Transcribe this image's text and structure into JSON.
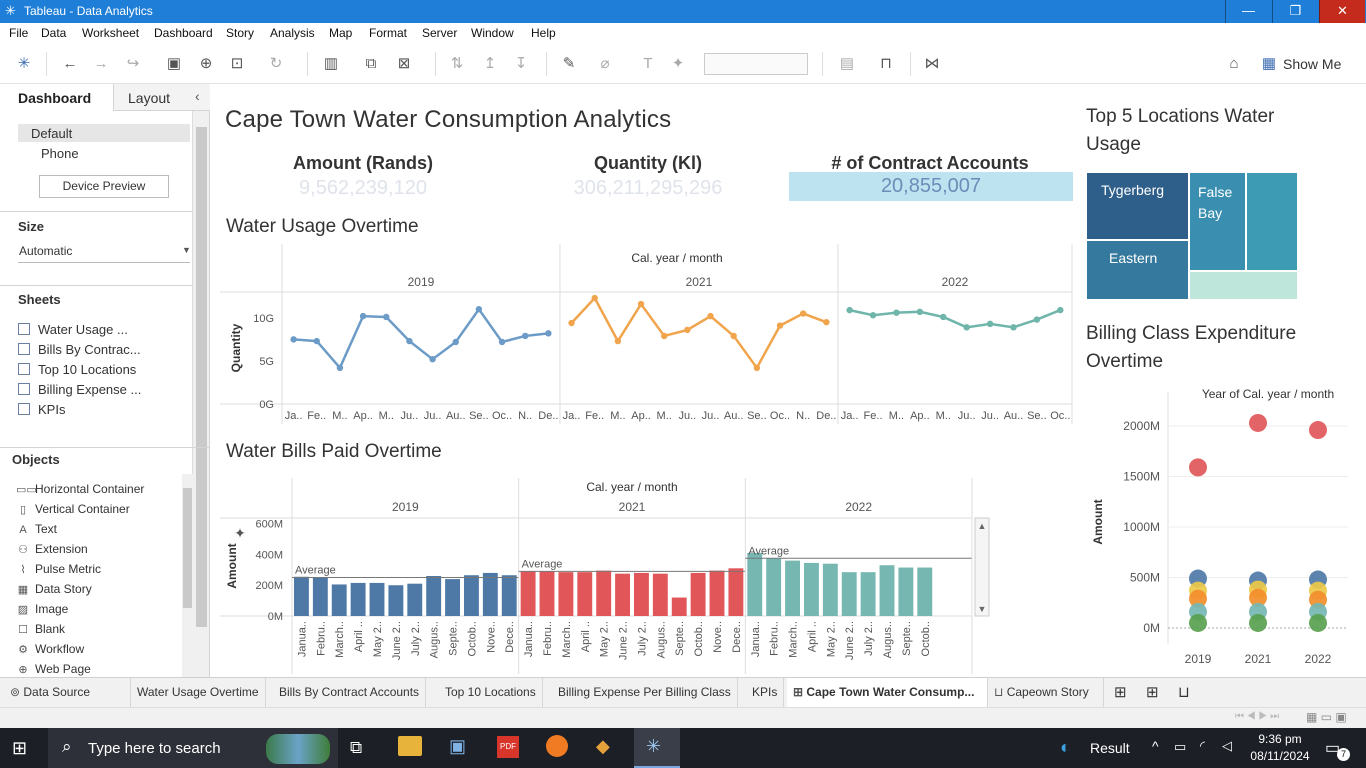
{
  "window": {
    "title": "Tableau - Data Analytics"
  },
  "menu": [
    "File",
    "Data",
    "Worksheet",
    "Dashboard",
    "Story",
    "Analysis",
    "Map",
    "Format",
    "Server",
    "Window",
    "Help"
  ],
  "toolbar": {
    "show_me": "Show Me"
  },
  "left": {
    "tab_dashboard": "Dashboard",
    "tab_layout": "Layout",
    "device_default": "Default",
    "device_phone": "Phone",
    "device_preview": "Device Preview",
    "size_label": "Size",
    "size_value": "Automatic",
    "sheets_label": "Sheets",
    "sheets": [
      "Water Usage ...",
      "Bills By Contrac...",
      "Top 10 Locations",
      "Billing Expense ...",
      "KPIs"
    ],
    "objects_label": "Objects",
    "objects": [
      {
        "label": "Horizontal Container",
        "icon": "horizontal-container-icon"
      },
      {
        "label": "Vertical Container",
        "icon": "vertical-container-icon"
      },
      {
        "label": "Text",
        "icon": "text-icon"
      },
      {
        "label": "Extension",
        "icon": "extension-icon"
      },
      {
        "label": "Pulse Metric",
        "icon": "pulse-metric-icon"
      },
      {
        "label": "Data Story",
        "icon": "data-story-icon"
      },
      {
        "label": "Image",
        "icon": "image-icon"
      },
      {
        "label": "Blank",
        "icon": "blank-icon"
      },
      {
        "label": "Workflow",
        "icon": "workflow-icon"
      },
      {
        "label": "Web Page",
        "icon": "web-page-icon"
      }
    ]
  },
  "dashboard": {
    "title": "Cape Town Water Consumption Analytics",
    "kpis": [
      {
        "label": "Amount (Rands)",
        "value": "9,562,239,120"
      },
      {
        "label": "Quantity (Kl)",
        "value": "306,211,295,296"
      },
      {
        "label": "# of Contract Accounts",
        "value": "20,855,007"
      }
    ],
    "usage_title": "Water Usage Overtime",
    "bills_title": "Water Bills Paid Overtime",
    "top5_title": "Top 5 Locations Water Usage",
    "billing_title": "Billing Class Expenditure Overtime"
  },
  "chart_data": [
    {
      "type": "line",
      "name": "Water Usage Overtime",
      "header": "Cal. year / month",
      "ylabel": "Quantity",
      "yticks": [
        "10G",
        "5G",
        "0G"
      ],
      "ylim": [
        0,
        13
      ],
      "panels": [
        {
          "year": "2019",
          "color": "#6b9bc6",
          "x": [
            "Ja..",
            "Fe..",
            "M..",
            "Ap..",
            "M..",
            "Ju..",
            "Ju..",
            "Au..",
            "Se..",
            "Oc..",
            "N..",
            "De.."
          ],
          "values": [
            7.5,
            7.3,
            4.2,
            10.2,
            10.1,
            7.3,
            5.2,
            7.2,
            11.0,
            7.2,
            7.9,
            8.2
          ]
        },
        {
          "year": "2021",
          "color": "#f0a44b",
          "x": [
            "Ja..",
            "Fe..",
            "M..",
            "Ap..",
            "M..",
            "Ju..",
            "Ju..",
            "Au..",
            "Se..",
            "Oc..",
            "N..",
            "De.."
          ],
          "values": [
            9.4,
            12.3,
            7.3,
            11.6,
            7.9,
            8.6,
            10.2,
            7.9,
            4.2,
            9.1,
            10.5,
            9.5
          ]
        },
        {
          "year": "2022",
          "color": "#6fb5aa",
          "x": [
            "Ja..",
            "Fe..",
            "M..",
            "Ap..",
            "M..",
            "Ju..",
            "Ju..",
            "Au..",
            "Se..",
            "Oc.."
          ],
          "values": [
            10.9,
            10.3,
            10.6,
            10.7,
            10.1,
            8.9,
            9.3,
            8.9,
            9.8,
            10.9
          ]
        }
      ]
    },
    {
      "type": "bar",
      "name": "Water Bills Paid Overtime",
      "header": "Cal. year / month",
      "ylabel": "Amount",
      "yticks": [
        "600M",
        "400M",
        "200M",
        "0M"
      ],
      "ylim": [
        0,
        650
      ],
      "reference_label": "Average",
      "panels": [
        {
          "year": "2019",
          "color": "#4e79a7",
          "average": 250,
          "x": [
            "Janua..",
            "Febru..",
            "March..",
            "April ..",
            "May 2..",
            "June 2..",
            "July 2..",
            "Augus..",
            "Septe..",
            "Octob..",
            "Nove..",
            "Dece.."
          ],
          "values": [
            255,
            250,
            205,
            215,
            215,
            200,
            210,
            260,
            240,
            265,
            280,
            265
          ]
        },
        {
          "year": "2021",
          "color": "#e15759",
          "average": 290,
          "x": [
            "Janua..",
            "Febru..",
            "March..",
            "April ..",
            "May 2..",
            "June 2..",
            "July 2..",
            "Augus..",
            "Septe..",
            "Octob..",
            "Nove..",
            "Dece.."
          ],
          "values": [
            290,
            290,
            285,
            285,
            295,
            275,
            280,
            275,
            120,
            280,
            295,
            310
          ]
        },
        {
          "year": "2022",
          "color": "#76b7b2",
          "average": 375,
          "x": [
            "Janua..",
            "Febru..",
            "March..",
            "April ..",
            "May 2..",
            "June 2..",
            "July 2..",
            "Augus..",
            "Septe..",
            "Octob.."
          ],
          "values": [
            410,
            375,
            360,
            345,
            340,
            285,
            285,
            330,
            315,
            315
          ]
        }
      ]
    },
    {
      "type": "treemap",
      "name": "Top 5 Locations Water Usage",
      "items": [
        {
          "label": "Tygerberg",
          "color": "#2e5f8a"
        },
        {
          "label": "False Bay",
          "color": "#3a8fb0"
        },
        {
          "label": "",
          "color": "#3d9bb3"
        },
        {
          "label": "Eastern",
          "color": "#357a9e"
        },
        {
          "label": "",
          "color": "#bfe6da"
        }
      ]
    },
    {
      "type": "scatter",
      "name": "Billing Class Expenditure Overtime",
      "header": "Year of Cal. year / month",
      "ylabel": "Amount",
      "yticks": [
        "2000M",
        "1500M",
        "1000M",
        "500M",
        "0M"
      ],
      "ylim": [
        0,
        2000
      ],
      "x": [
        "2019",
        "2021",
        "2022"
      ],
      "series": [
        {
          "color": "#e15759",
          "values": [
            1590,
            2030,
            1960
          ]
        },
        {
          "color": "#4e79a7",
          "values": [
            490,
            470,
            480
          ]
        },
        {
          "color": "#edc948",
          "values": [
            370,
            380,
            370
          ]
        },
        {
          "color": "#f28e2b",
          "values": [
            290,
            300,
            280
          ]
        },
        {
          "color": "#76b7b2",
          "values": [
            160,
            160,
            160
          ]
        },
        {
          "color": "#59a14f",
          "values": [
            50,
            50,
            50
          ]
        }
      ]
    }
  ],
  "tabs": [
    "Data Source",
    "Water Usage Overtime",
    "Bills By Contract Accounts",
    "Top 10 Locations",
    "Billing Expense Per Billing Class",
    "KPIs",
    "Cape Town Water Consump...",
    "Capeown Story"
  ],
  "taskbar": {
    "search": "Type here to search",
    "weather": "Result",
    "time": "9:36 pm",
    "date": "08/11/2024",
    "badge": "7"
  }
}
